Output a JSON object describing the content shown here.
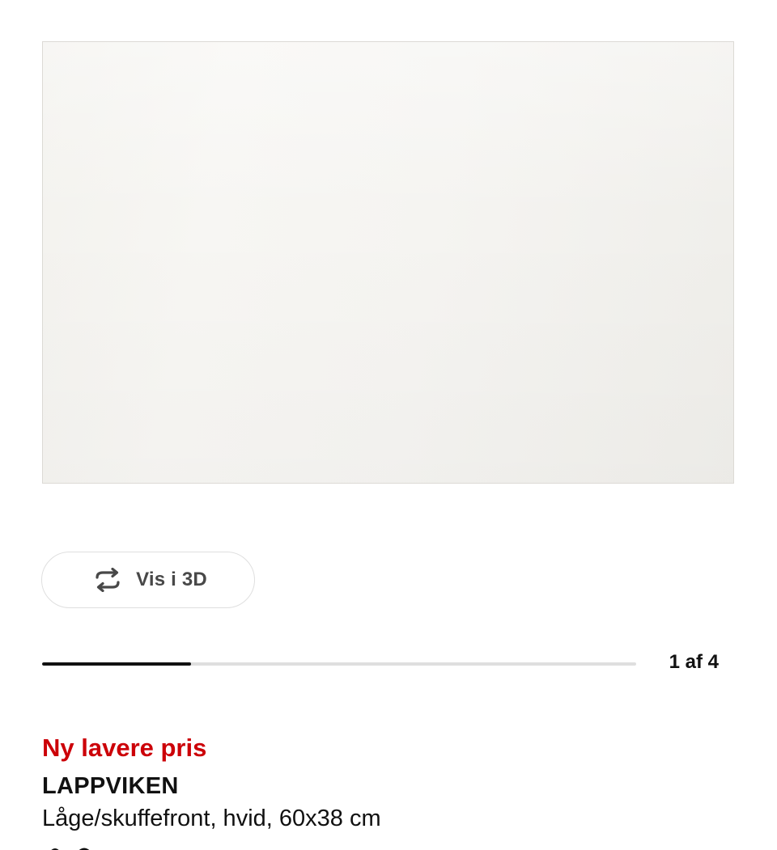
{
  "gallery": {
    "view_3d_label": "Vis i 3D",
    "view_3d_icon": "rotate-arrows-icon",
    "pager_text": "1 af 4",
    "progress_fraction": 0.25
  },
  "product": {
    "badge": "Ny lavere pris",
    "badge_color": "#cc0008",
    "name": "LAPPVIKEN",
    "description": "Låge/skuffefront, hvid, 60x38 cm"
  }
}
